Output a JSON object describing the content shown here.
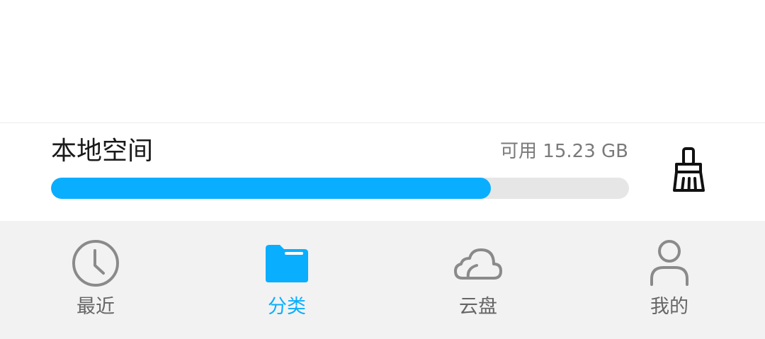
{
  "storage": {
    "title": "本地空间",
    "available_text": "可用 15.23 GB",
    "used_fraction": 0.761
  },
  "icons": {
    "clean": "broom-icon"
  },
  "colors": {
    "accent": "#0aaeff",
    "track": "#e6e6e6",
    "tab_text": "#666666",
    "tab_bar_bg": "#f2f2f2"
  },
  "tabs": [
    {
      "label": "最近",
      "icon": "clock-icon",
      "active": false
    },
    {
      "label": "分类",
      "icon": "folder-icon",
      "active": true
    },
    {
      "label": "云盘",
      "icon": "cloud-icon",
      "active": false
    },
    {
      "label": "我的",
      "icon": "person-icon",
      "active": false
    }
  ]
}
